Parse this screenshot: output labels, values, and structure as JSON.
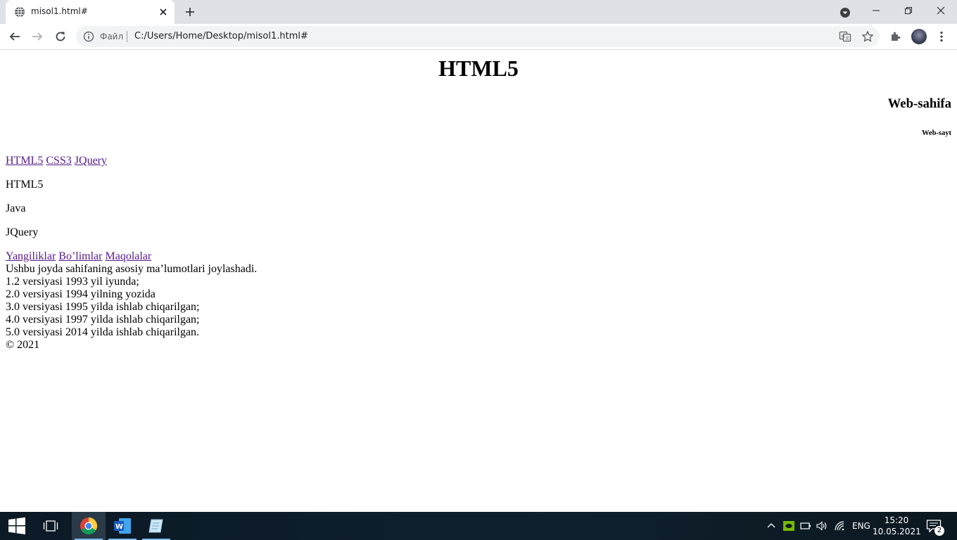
{
  "browser": {
    "tab": {
      "title": "misol1.html#"
    },
    "address": {
      "scheme_label": "Файл",
      "url": "C:/Users/Home/Desktop/misol1.html#"
    }
  },
  "page": {
    "h1": "HTML5",
    "h3": "Web-sahifa",
    "h6": "Web-sayt",
    "nav1": [
      "HTML5",
      "CSS3",
      "JQuery"
    ],
    "paragraphs": [
      "HTML5",
      "Java",
      "JQuery"
    ],
    "nav2": [
      "Yangiliklar",
      "Bo’limlar",
      "Maqolalar"
    ],
    "lines": [
      "Ushbu joyda sahifaning asosiy ma’lumotlari joylashadi.",
      "1.2 versiyasi 1993 yil iyunda;",
      "2.0 versiyasi 1994 yilning yozida",
      "3.0 versiyasi 1995 yilda ishlab chiqarilgan;",
      "4.0 versiyasi 1997 yilda ishlab chiqarilgan;",
      "5.0 versiyasi 2014 yilda ishlab chiqarilgan.",
      "© 2021"
    ]
  },
  "taskbar": {
    "language": "ENG",
    "time": "15:20",
    "date": "10.05.2021",
    "notification_count": "2"
  },
  "colors": {
    "link_visited": "#551a8b",
    "tabstrip": "#dee1e6",
    "taskbar": "#0f1f2c"
  }
}
